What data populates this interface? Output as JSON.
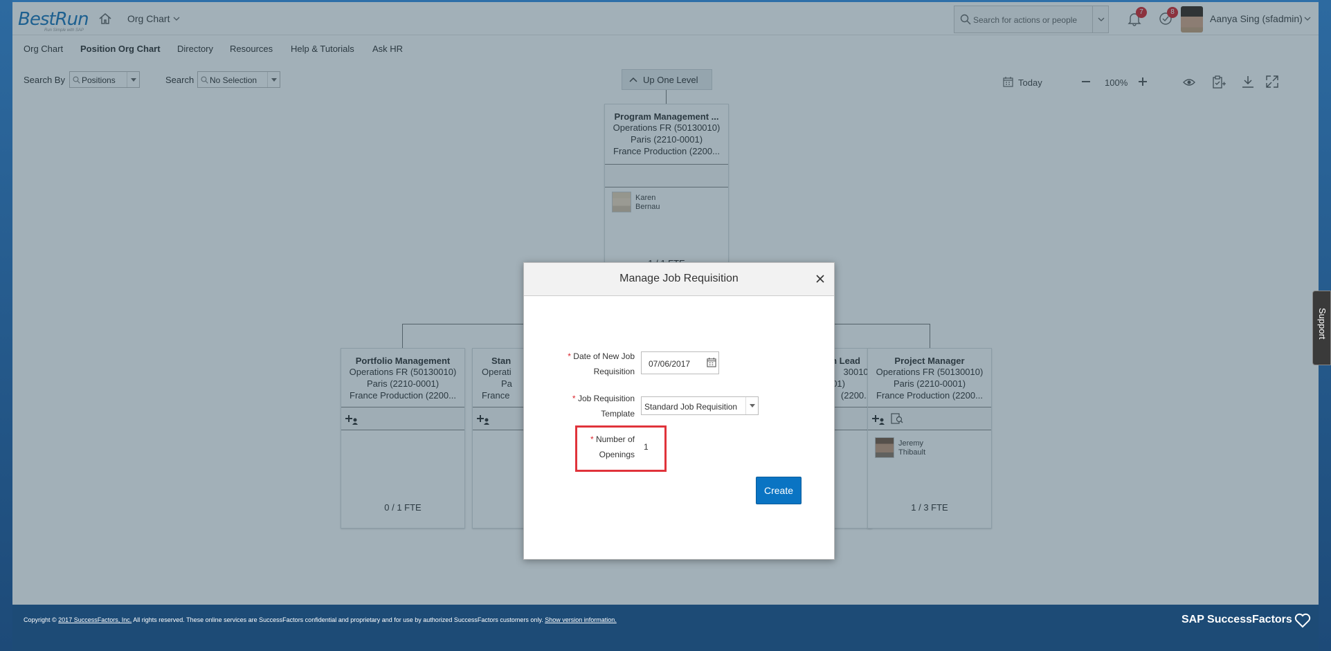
{
  "header": {
    "logo_text": "BestRun",
    "logo_sub": "Run Simple with SAP",
    "module": "Org Chart",
    "search_placeholder": "Search for actions or people",
    "notifications_count": "7",
    "todo_count": "8",
    "user_name": "Aanya Sing (sfadmin)"
  },
  "subnav": {
    "items": [
      "Org Chart",
      "Position Org Chart",
      "Directory",
      "Resources",
      "Help & Tutorials",
      "Ask HR"
    ]
  },
  "toolbar": {
    "search_by_label": "Search By",
    "search_by_value": "Positions",
    "search_label": "Search",
    "search_value": "No Selection",
    "up_level": "Up One Level",
    "date_label": "Today",
    "zoom": "100%"
  },
  "org": {
    "top": {
      "title": "Program Management ...",
      "line1": "Operations FR (50130010)",
      "line2": "Paris (2210-0001)",
      "line3": "France Production (2200...",
      "person_first": "Karen",
      "person_last": "Bernau",
      "fte": "1 / 1 FTE"
    },
    "cards": [
      {
        "title": "Portfolio Management",
        "line1": "Operations FR (50130010)",
        "line2": "Paris (2210-0001)",
        "line3": "France Production (2200...",
        "fte": "0 / 1 FTE"
      },
      {
        "title": "Stan",
        "line1": "Operati",
        "line2": "Pa",
        "line3": "France"
      },
      {
        "title": "n Lead",
        "line1": "30010)",
        "line2": "01)",
        "line3": "(2200..."
      },
      {
        "title": "Project Manager",
        "line1": "Operations FR (50130010)",
        "line2": "Paris (2210-0001)",
        "line3": "France Production (2200...",
        "person_first": "Jeremy",
        "person_last": "Thibault",
        "fte": "1 / 3 FTE"
      }
    ]
  },
  "dialog": {
    "title": "Manage Job Requisition",
    "date_label_line1": "Date of New Job",
    "date_label_line2": "Requisition",
    "date_value": "07/06/2017",
    "template_label_line1": "Job Requisition",
    "template_label_line2": "Template",
    "template_value": "Standard Job Requisition",
    "openings_label_line1": "Number of",
    "openings_label_line2": "Openings",
    "openings_value": "1",
    "create_label": "Create",
    "required_mark": "*"
  },
  "footer": {
    "copyright_prefix": "Copyright ©",
    "company_link": "2017 SuccessFactors, Inc.",
    "copyright_text": "All rights reserved. These online services are SuccessFactors confidential and proprietary and for use by authorized SuccessFactors customers only.",
    "version_link": "Show version information.",
    "brand": "SAP SuccessFactors"
  },
  "support_label": "Support"
}
